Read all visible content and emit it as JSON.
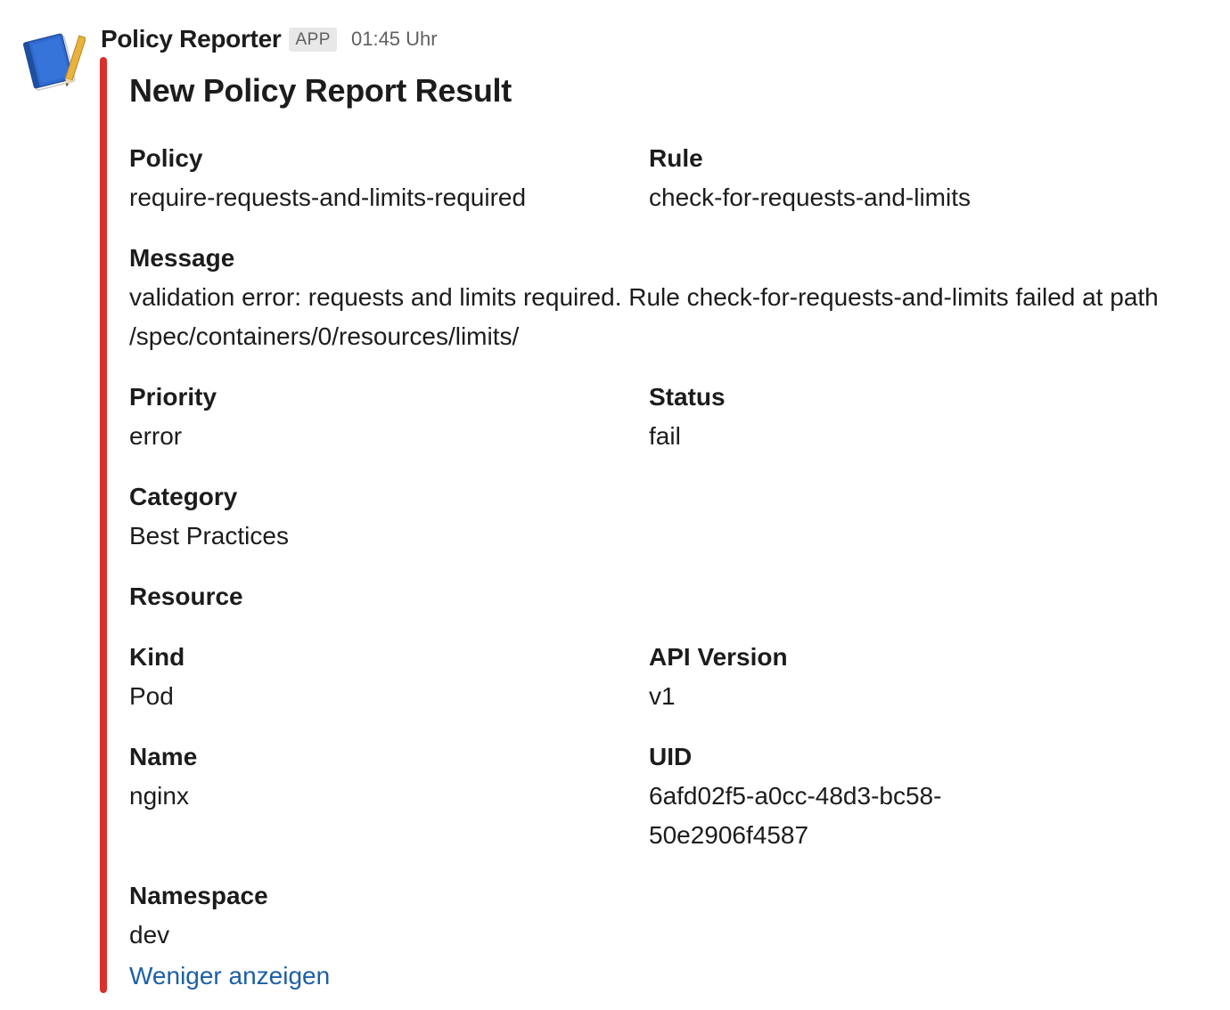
{
  "header": {
    "sender": "Policy Reporter",
    "badge": "APP",
    "timestamp": "01:45 Uhr",
    "avatar_icon": "notebook-pencil-icon"
  },
  "attachment": {
    "accent_color": "#d8312b",
    "title": "New Policy Report Result",
    "policy": {
      "label": "Policy",
      "value": "require-requests-and-limits-required"
    },
    "rule": {
      "label": "Rule",
      "value": "check-for-requests-and-limits"
    },
    "message": {
      "label": "Message",
      "value": "validation error: requests and limits required. Rule check-for-requests-and-limits failed at path /spec/containers/0/resources/limits/"
    },
    "priority": {
      "label": "Priority",
      "value": "error"
    },
    "status": {
      "label": "Status",
      "value": "fail"
    },
    "category": {
      "label": "Category",
      "value": "Best Practices"
    },
    "resource_heading": "Resource",
    "kind": {
      "label": "Kind",
      "value": "Pod"
    },
    "api_version": {
      "label": "API Version",
      "value": "v1"
    },
    "name": {
      "label": "Name",
      "value": "nginx"
    },
    "uid": {
      "label": "UID",
      "value": "6afd02f5-a0cc-48d3-bc58-50e2906f4587"
    },
    "namespace": {
      "label": "Namespace",
      "value": "dev"
    },
    "show_less_label": "Weniger anzeigen"
  }
}
